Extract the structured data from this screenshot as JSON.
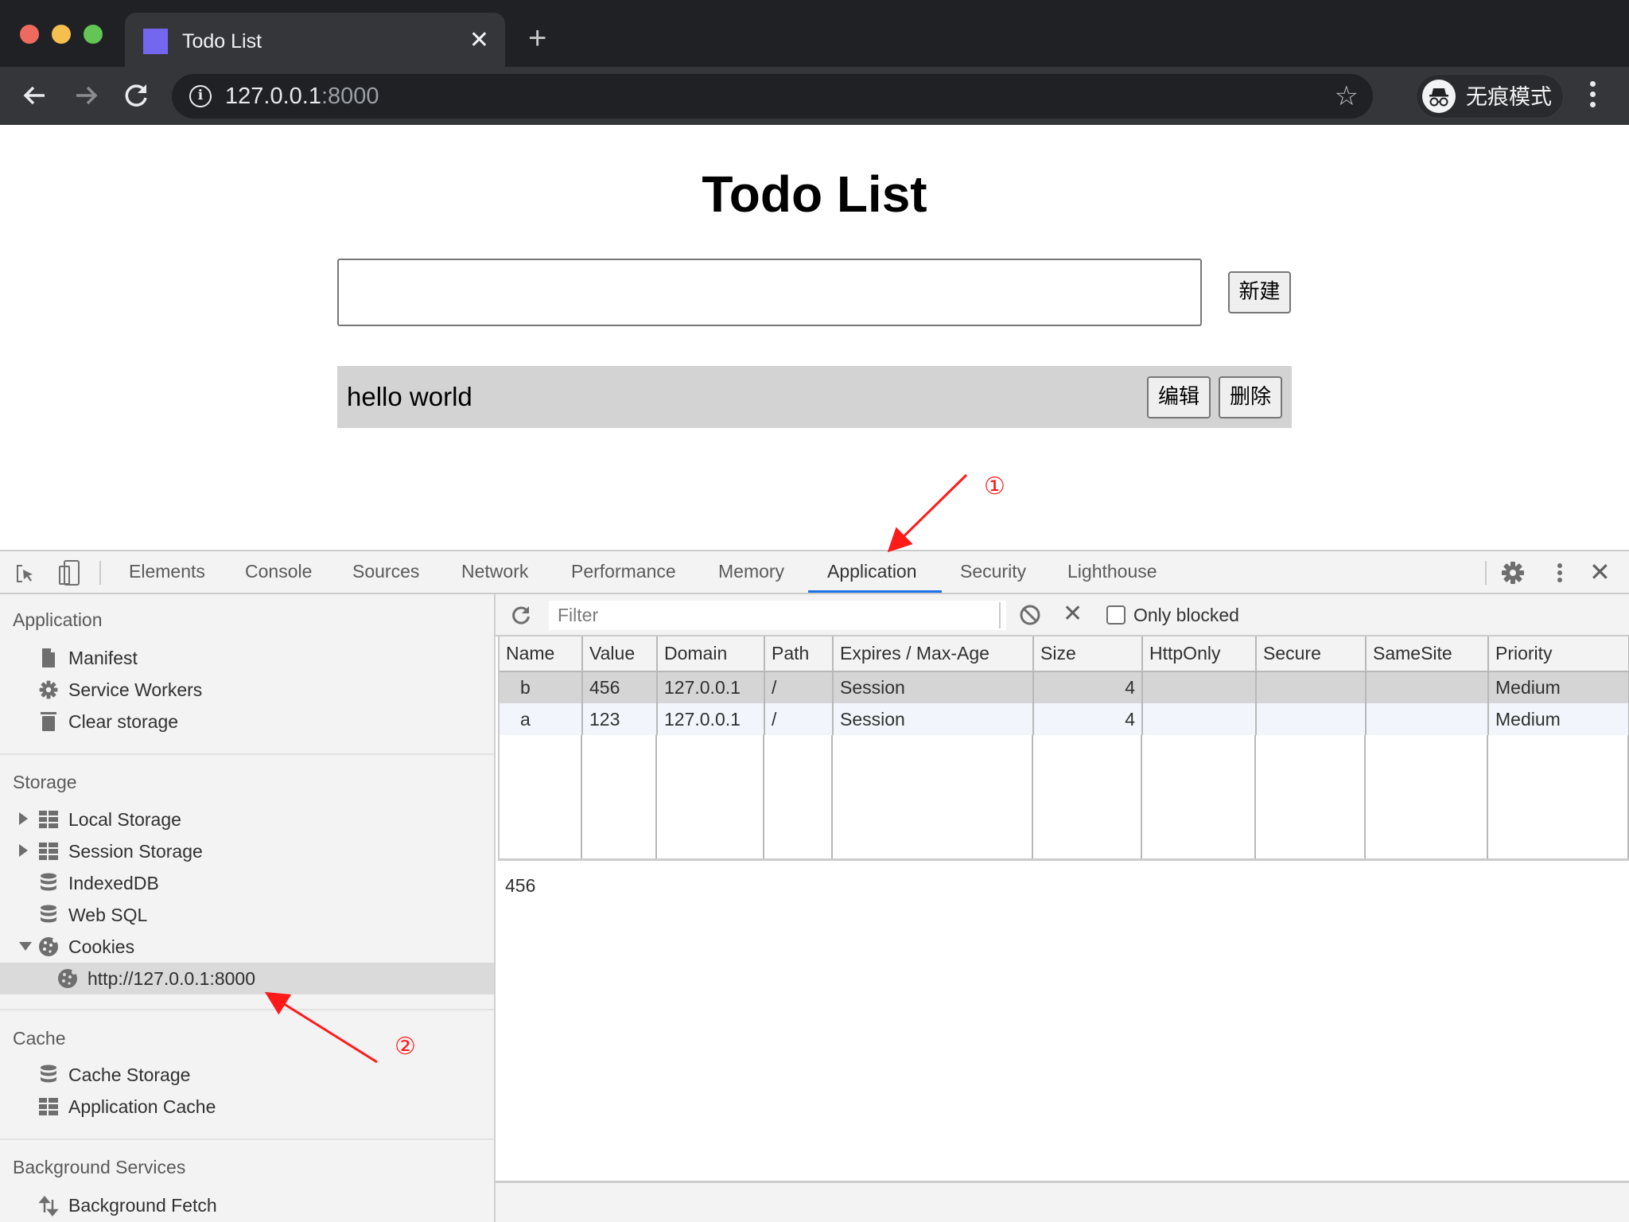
{
  "browser": {
    "tab_title": "Todo List",
    "tab_favicon_color": "#7367f0",
    "url_host": "127.0.0.1",
    "url_port": ":8000",
    "incognito_label": "无痕模式"
  },
  "page": {
    "title": "Todo List",
    "new_input": {
      "value": "",
      "placeholder": ""
    },
    "new_button": "新建",
    "todos": [
      {
        "text": "hello world",
        "edit_label": "编辑",
        "delete_label": "删除"
      }
    ]
  },
  "annotations": [
    {
      "label": "①",
      "color": "#ff1a1a",
      "target": "Application tab"
    },
    {
      "label": "②",
      "color": "#ff1a1a",
      "target": "http://127.0.0.1:8000 cookies item"
    }
  ],
  "devtools": {
    "tabs": [
      "Elements",
      "Console",
      "Sources",
      "Network",
      "Performance",
      "Memory",
      "Application",
      "Security",
      "Lighthouse"
    ],
    "active_tab": "Application",
    "accent_color": "#1a73e8",
    "sidebar": {
      "application": {
        "title": "Application",
        "items": [
          {
            "label": "Manifest",
            "icon": "document-icon"
          },
          {
            "label": "Service Workers",
            "icon": "gear-icon"
          },
          {
            "label": "Clear storage",
            "icon": "trash-icon"
          }
        ]
      },
      "storage": {
        "title": "Storage",
        "items": [
          {
            "label": "Local Storage",
            "icon": "grid-icon",
            "expandable": true,
            "expanded": false
          },
          {
            "label": "Session Storage",
            "icon": "grid-icon",
            "expandable": true,
            "expanded": false
          },
          {
            "label": "IndexedDB",
            "icon": "database-icon"
          },
          {
            "label": "Web SQL",
            "icon": "database-icon"
          },
          {
            "label": "Cookies",
            "icon": "cookie-icon",
            "expandable": true,
            "expanded": true
          },
          {
            "label": "http://127.0.0.1:8000",
            "icon": "cookie-icon",
            "selected": true
          }
        ]
      },
      "cache": {
        "title": "Cache",
        "items": [
          {
            "label": "Cache Storage",
            "icon": "database-icon"
          },
          {
            "label": "Application Cache",
            "icon": "grid-icon"
          }
        ]
      },
      "background": {
        "title": "Background Services",
        "items": [
          {
            "label": "Background Fetch",
            "icon": "up-down-arrows-icon"
          }
        ]
      }
    },
    "toolbar": {
      "filter_placeholder": "Filter",
      "filter_value": "",
      "only_blocked_label": "Only blocked",
      "only_blocked_checked": false
    },
    "cookies_table": {
      "columns": [
        "Name",
        "Value",
        "Domain",
        "Path",
        "Expires / Max-Age",
        "Size",
        "HttpOnly",
        "Secure",
        "SameSite",
        "Priority"
      ],
      "rows": [
        {
          "name": "b",
          "value": "456",
          "domain": "127.0.0.1",
          "path": "/",
          "expires": "Session",
          "size": "4",
          "httponly": "",
          "secure": "",
          "samesite": "",
          "priority": "Medium",
          "selected": true
        },
        {
          "name": "a",
          "value": "123",
          "domain": "127.0.0.1",
          "path": "/",
          "expires": "Session",
          "size": "4",
          "httponly": "",
          "secure": "",
          "samesite": "",
          "priority": "Medium",
          "selected": false
        }
      ]
    },
    "preview_value": "456"
  }
}
